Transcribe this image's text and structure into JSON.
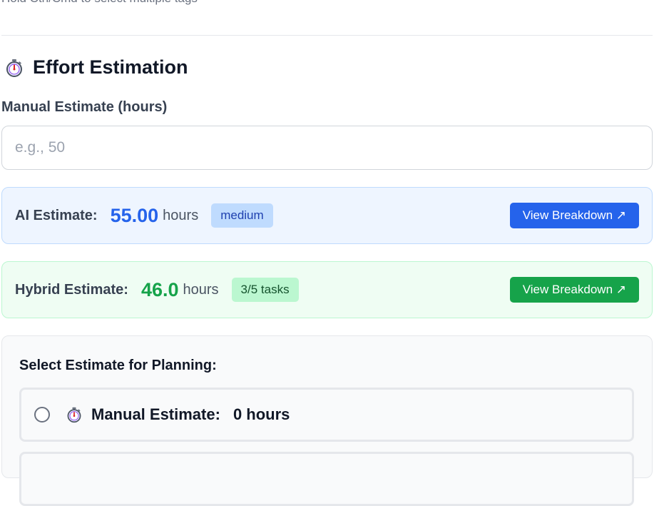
{
  "tags_hint": "Hold Ctrl/Cmd to select multiple tags",
  "section": {
    "title": "Effort Estimation",
    "icon": "stopwatch-icon"
  },
  "manual": {
    "label": "Manual Estimate (hours)",
    "placeholder": "e.g., 50",
    "value": ""
  },
  "ai_estimate": {
    "label": "AI Estimate:",
    "value": "55.00",
    "unit": "hours",
    "badge": "medium",
    "button": "View Breakdown ↗"
  },
  "hybrid_estimate": {
    "label": "Hybrid Estimate:",
    "value": "46.0",
    "unit": "hours",
    "badge": "3/5 tasks",
    "button": "View Breakdown ↗"
  },
  "planning": {
    "title": "Select Estimate for Planning:",
    "options": [
      {
        "label": "Manual Estimate:",
        "value": "0 hours",
        "icon": "stopwatch-icon",
        "selected": false
      }
    ]
  },
  "colors": {
    "ai_accent": "#2563eb",
    "hybrid_accent": "#16a34a"
  }
}
